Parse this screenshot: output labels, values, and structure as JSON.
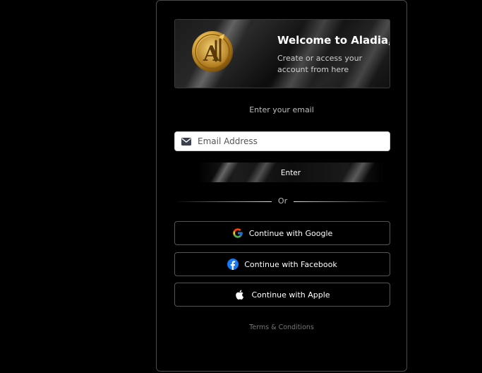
{
  "banner": {
    "title": "Welcome to Aladia,",
    "subtitle": "Create or access your account from here",
    "logo_icon": "aladia-gold-logo-icon"
  },
  "form": {
    "prompt": "Enter your email",
    "email_placeholder": "Email Address",
    "email_value": "",
    "email_icon": "envelope-icon",
    "enter_label": "Enter",
    "or_label": "Or"
  },
  "social": {
    "google": {
      "label": "Continue with Google",
      "icon": "google-icon"
    },
    "facebook": {
      "label": "Continue with Facebook",
      "icon": "facebook-icon",
      "color": "#1877F2"
    },
    "apple": {
      "label": "Continue with Apple",
      "icon": "apple-icon"
    }
  },
  "footer": {
    "terms_label": "Terms & Conditions"
  },
  "colors": {
    "background": "#000000",
    "card_border": "#4a4a4a",
    "gold": "#d4a53a"
  }
}
